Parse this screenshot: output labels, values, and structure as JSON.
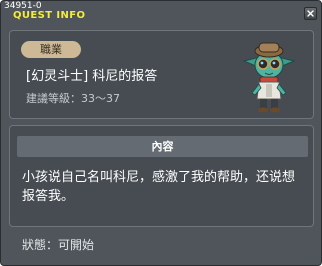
{
  "window": {
    "quest_id": "34951-0",
    "title": "QUEST INFO"
  },
  "quest": {
    "category": "職業",
    "name": "[幻灵斗士] 科尼的报答",
    "level_requirement": "建議等級：33～37"
  },
  "content": {
    "header": "內容",
    "text": "小孩说自己名叫科尼，感激了我的帮助，还说想报答我。"
  },
  "status": "狀態：可開始",
  "colors": {
    "title_yellow": "#f4ec3a",
    "window_bg": "#4f555b",
    "panel_bg": "#464c52",
    "badge_bg": "#cdb996",
    "header_bg": "#646b72"
  },
  "icons": {
    "close": "close-icon",
    "npc": "npc-portrait"
  }
}
